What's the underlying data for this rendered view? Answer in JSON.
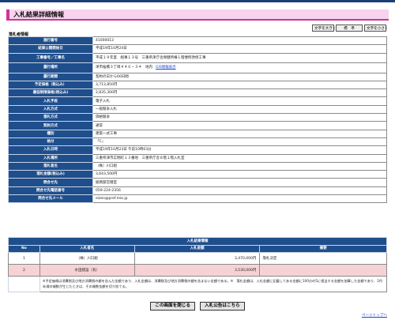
{
  "page": {
    "title": "入札結果詳細情報",
    "section_label": "落札者情報"
  },
  "font_buttons": {
    "larger": "文字を大きく",
    "standard": "標　準",
    "smaller": "文字を小さく"
  },
  "info_rows": [
    {
      "label": "施行番号",
      "value": "41000013"
    },
    {
      "label": "結果公開開始日",
      "value": "平成19年10月24日"
    },
    {
      "label": "工事番号／工事名",
      "value": "平成１９年度　総事１３号　三重県津庁舎保健所棟１階便所改修工事"
    },
    {
      "label": "履行場所",
      "value": "津市桜橋３丁目４４６－３４　地内",
      "link": "GIS情報表示"
    },
    {
      "label": "履行期間",
      "value": "契約の日から60日間"
    },
    {
      "label": "予定価格（税込み）",
      "value": "3,713,850円"
    },
    {
      "label": "最低制限価格(税込み)",
      "value": "2,835,300円"
    },
    {
      "label": "入札手段",
      "value": "電子入札"
    },
    {
      "label": "入札方式",
      "value": "一般競争入札"
    },
    {
      "label": "落札方式",
      "value": "価格競争"
    },
    {
      "label": "契約方式",
      "value": "通常"
    },
    {
      "label": "種別",
      "value": "建築一式工事"
    },
    {
      "label": "格付",
      "value": "「C」"
    },
    {
      "label": "入札日時",
      "value": "平成19年10月23日 午前10時03分"
    },
    {
      "label": "入札場所",
      "value": "三重県津市広明町１３番地　三重県庁舎８階１階入札室"
    },
    {
      "label": "落札者名",
      "value": "（株）川口組"
    },
    {
      "label": "落札金額(税込み)",
      "value": "3,643,500円"
    },
    {
      "label": "問合せ先",
      "value": "総務部営繕室"
    },
    {
      "label": "問合せ先電話番号",
      "value": "059-224-2356"
    },
    {
      "label": "問合せ先メール",
      "value": "eizen@pref.mie.jp"
    }
  ],
  "results": {
    "caption": "入札結果情報",
    "headers": [
      "No",
      "入札者名",
      "入札金額",
      "摘要"
    ],
    "rows": [
      {
        "no": "1",
        "name": "（株）川口組",
        "amount": "3,470,000円",
        "remark": "落札決定"
      },
      {
        "no": "2",
        "name": "水田建設（有）",
        "amount": "3,530,000円",
        "remark": ""
      }
    ],
    "note_label": "備考",
    "note_text": "※予定価格は消費税及び地方消費税の額を含んだ金額であり、入札金額は、消費税及び地方消費税の額を含まない金額である。※　落札金額は、入札金額に記載してある金額に100分の5に相当する金額を加算した金額であり、1円未満の端数が生じたときは、その端数金額を切り捨てる。"
  },
  "bottom_buttons": {
    "close": "この画面を閉じる",
    "notice": "入札公告はこちら"
  },
  "page_top_link": "ページトップへ"
}
